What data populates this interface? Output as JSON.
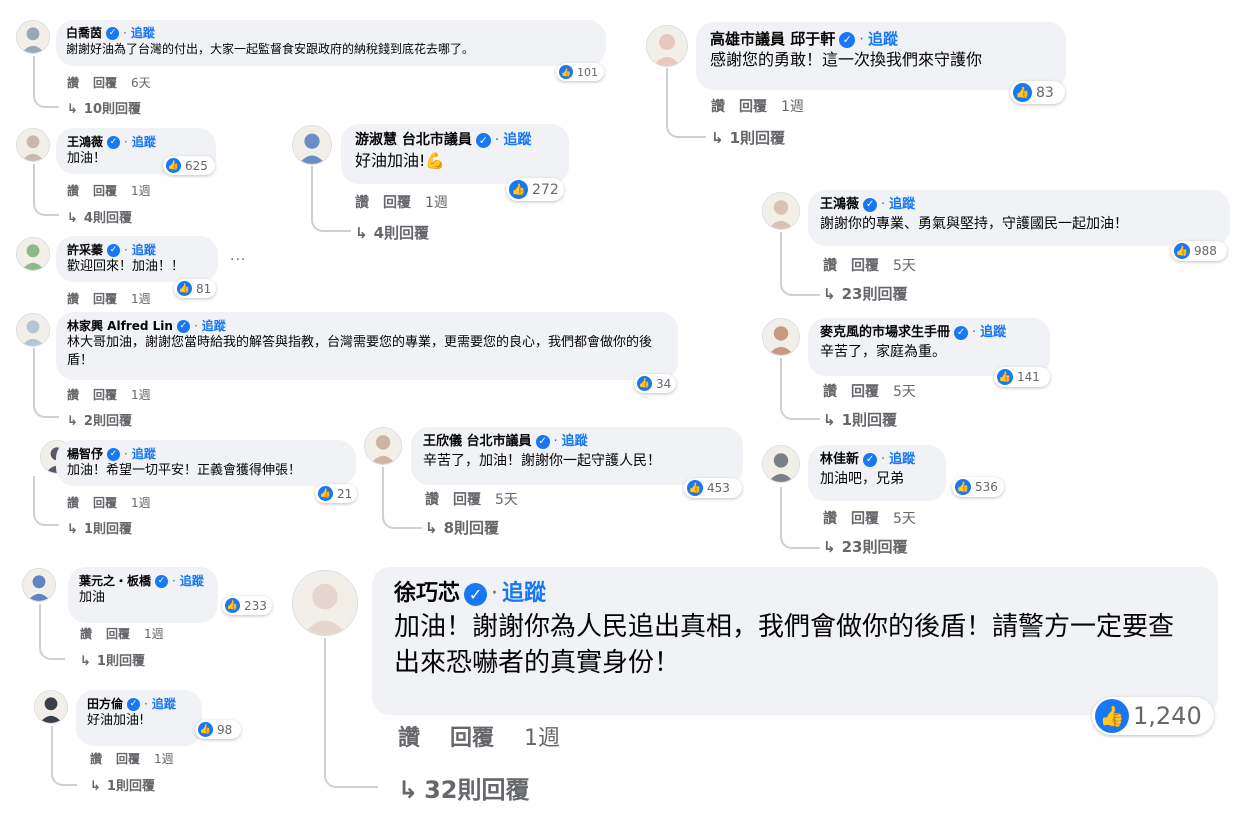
{
  "ui": {
    "verified_icon": "verified-badge-icon",
    "separator": "·",
    "follow_label": "追蹤",
    "like_action": "讚",
    "reply_action": "回覆",
    "like_icon": "thumbs-up-icon",
    "reply_arrow": "↳"
  },
  "comments": [
    {
      "name": "白喬茵",
      "text": "謝謝好油為了台灣的付出，大家一起監督食安跟政府的納稅錢到底花去哪了。",
      "likes": "101",
      "time": "6天",
      "replies": "10則回覆"
    },
    {
      "name": "高雄市議員 邱于軒",
      "text": "感謝您的勇敢！這一次換我們來守護你",
      "likes": "83",
      "time": "1週",
      "replies": "1則回覆"
    },
    {
      "name": "王鴻薇",
      "text": "加油！",
      "likes": "625",
      "time": "1週",
      "replies": "4則回覆"
    },
    {
      "name": "游淑慧 台北市議員",
      "text": "好油加油!💪",
      "likes": "272",
      "time": "1週",
      "replies": "4則回覆"
    },
    {
      "name": "王鴻薇",
      "text": "謝謝你的專業、勇氣與堅持，守護國民一起加油！",
      "likes": "988",
      "time": "5天",
      "replies": "23則回覆"
    },
    {
      "name": "許采蓁",
      "text": "歡迎回來！加油！！",
      "likes": "81",
      "time": "1週",
      "replies": ""
    },
    {
      "name": "林家興 Alfred Lin",
      "text": "林大哥加油，謝謝您當時給我的解答與指教，台灣需要您的專業，更需要您的良心，我們都會做你的後盾！",
      "likes": "34",
      "time": "1週",
      "replies": "2則回覆"
    },
    {
      "name": "麥克風的市場求生手冊",
      "text": "辛苦了，家庭為重。",
      "likes": "141",
      "time": "5天",
      "replies": "1則回覆"
    },
    {
      "name": "楊智伃",
      "text": "加油！希望一切平安！正義會獲得伸張！",
      "likes": "21",
      "time": "1週",
      "replies": "1則回覆"
    },
    {
      "name": "王欣儀 台北市議員",
      "text": "辛苦了，加油！謝謝你一起守護人民！",
      "likes": "453",
      "time": "5天",
      "replies": "8則回覆"
    },
    {
      "name": "林佳新",
      "text": "加油吧，兄弟",
      "likes": "536",
      "time": "5天",
      "replies": "23則回覆"
    },
    {
      "name": "葉元之・板橋",
      "text": "加油",
      "likes": "233",
      "time": "1週",
      "replies": "1則回覆"
    },
    {
      "name": "徐巧芯",
      "text": "加油！謝謝你為人民追出真相，我們會做你的後盾！請警方一定要查出來恐嚇者的真實身份！",
      "likes": "1,240",
      "time": "1週",
      "replies": "32則回覆"
    },
    {
      "name": "田方倫",
      "text": "好油加油!",
      "likes": "98",
      "time": "1週",
      "replies": "1則回覆"
    }
  ],
  "more_icon": "more-options-icon",
  "more_text": "···"
}
